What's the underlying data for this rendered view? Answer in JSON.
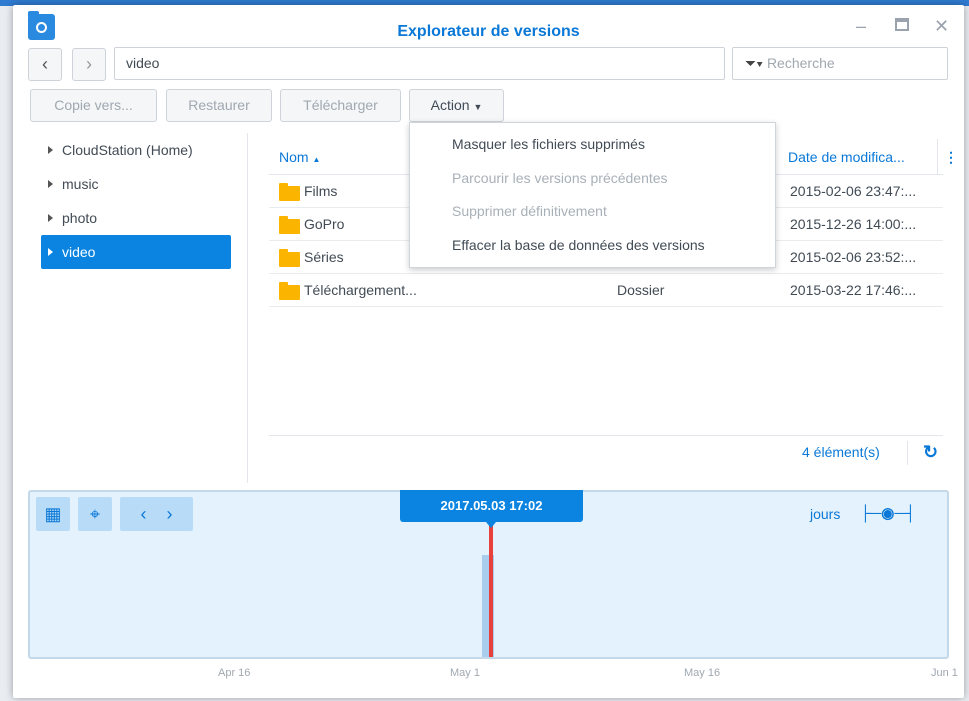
{
  "window": {
    "title": "Explorateur de versions"
  },
  "nav": {
    "path": "video",
    "search_placeholder": "Recherche"
  },
  "toolbar": {
    "copy": "Copie vers...",
    "restore": "Restaurer",
    "download": "Télécharger",
    "action": "Action"
  },
  "tree": [
    {
      "label": "CloudStation (Home)"
    },
    {
      "label": "music"
    },
    {
      "label": "photo"
    },
    {
      "label": "video",
      "selected": true
    }
  ],
  "grid": {
    "col_name": "Nom",
    "col_date": "Date de modifica...",
    "rows": [
      {
        "name": "Films",
        "type": "",
        "date": "2015-02-06 23:47:..."
      },
      {
        "name": "GoPro",
        "type": "",
        "date": "2015-12-26 14:00:..."
      },
      {
        "name": "Séries",
        "type": "",
        "date": "2015-02-06 23:52:..."
      },
      {
        "name": "Téléchargement...",
        "type": "Dossier",
        "date": "2015-03-22 17:46:..."
      }
    ],
    "count": "4 élément(s)"
  },
  "action_menu": [
    "Masquer les fichiers supprimés",
    "Parcourir les versions précédentes",
    "Supprimer définitivement",
    "Effacer la base de données des versions"
  ],
  "timeline": {
    "selected": "2017.05.03 17:02",
    "scale": "jours",
    "ticks": [
      "Apr 16",
      "May 1",
      "May 16",
      "Jun 1"
    ]
  },
  "colors": {
    "accent": "#0a84e0",
    "marker": "#e8413c"
  }
}
